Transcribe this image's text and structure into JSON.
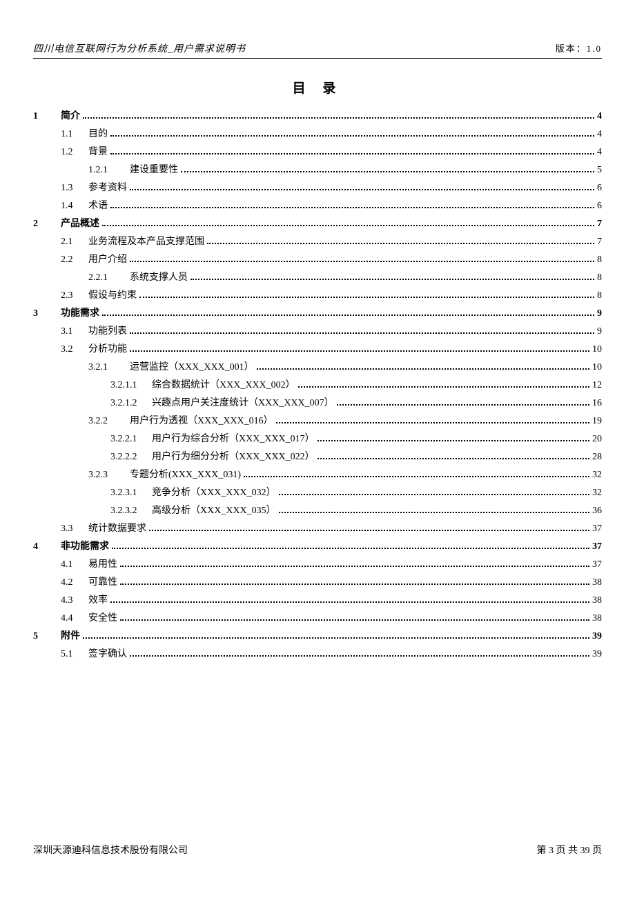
{
  "header": {
    "left": "四川电信互联网行为分析系统_用户需求说明书",
    "right": "版本：1.0"
  },
  "toc_title": "目 录",
  "toc": [
    {
      "level": 1,
      "num": "1",
      "title": "简介",
      "page": "4"
    },
    {
      "level": 2,
      "num": "1.1",
      "title": "目的",
      "page": "4"
    },
    {
      "level": 2,
      "num": "1.2",
      "title": "背景",
      "page": "4"
    },
    {
      "level": 3,
      "num": "1.2.1",
      "title": "建设重要性",
      "page": "5"
    },
    {
      "level": 2,
      "num": "1.3",
      "title": "参考资料",
      "page": "6"
    },
    {
      "level": 2,
      "num": "1.4",
      "title": "术语",
      "page": "6"
    },
    {
      "level": 1,
      "num": "2",
      "title": "产品概述",
      "page": "7"
    },
    {
      "level": 2,
      "num": "2.1",
      "title": "业务流程及本产品支撑范围",
      "page": "7"
    },
    {
      "level": 2,
      "num": "2.2",
      "title": "用户介绍",
      "page": "8"
    },
    {
      "level": 3,
      "num": "2.2.1",
      "title": "系统支撑人员",
      "page": "8"
    },
    {
      "level": 2,
      "num": "2.3",
      "title": "假设与约束",
      "page": "8"
    },
    {
      "level": 1,
      "num": "3",
      "title": "功能需求",
      "page": "9"
    },
    {
      "level": 2,
      "num": "3.1",
      "title": "功能列表",
      "page": "9"
    },
    {
      "level": 2,
      "num": "3.2",
      "title": "分析功能",
      "page": "10"
    },
    {
      "level": 3,
      "num": "3.2.1",
      "title": "运营监控（XXX_XXX_001）",
      "page": "10"
    },
    {
      "level": 4,
      "num": "3.2.1.1",
      "title": "综合数据统计（XXX_XXX_002）",
      "page": "12"
    },
    {
      "level": 4,
      "num": "3.2.1.2",
      "title": "兴趣点用户关注度统计（XXX_XXX_007）",
      "page": "16"
    },
    {
      "level": 3,
      "num": "3.2.2",
      "title": "用户行为透视（XXX_XXX_016）",
      "page": "19"
    },
    {
      "level": 4,
      "num": "3.2.2.1",
      "title": "用户行为综合分析（XXX_XXX_017）",
      "page": "20"
    },
    {
      "level": 4,
      "num": "3.2.2.2",
      "title": "用户行为细分分析（XXX_XXX_022）",
      "page": "28"
    },
    {
      "level": 3,
      "num": "3.2.3",
      "title": "专题分析(XXX_XXX_031)",
      "page": "32"
    },
    {
      "level": 4,
      "num": "3.2.3.1",
      "title": "竞争分析（XXX_XXX_032）",
      "page": "32"
    },
    {
      "level": 4,
      "num": "3.2.3.2",
      "title": "高级分析（XXX_XXX_035）",
      "page": "36"
    },
    {
      "level": 2,
      "num": "3.3",
      "title": "统计数据要求",
      "page": "37"
    },
    {
      "level": 1,
      "num": "4",
      "title": "非功能需求",
      "page": "37"
    },
    {
      "level": 2,
      "num": "4.1",
      "title": "易用性",
      "page": "37"
    },
    {
      "level": 2,
      "num": "4.2",
      "title": "可靠性",
      "page": "38"
    },
    {
      "level": 2,
      "num": "4.3",
      "title": "效率",
      "page": "38"
    },
    {
      "level": 2,
      "num": "4.4",
      "title": "安全性",
      "page": "38"
    },
    {
      "level": 1,
      "num": "5",
      "title": "附件",
      "page": "39"
    },
    {
      "level": 2,
      "num": "5.1",
      "title": "签字确认",
      "page": "39"
    }
  ],
  "footer": {
    "left": "深圳天源迪科信息技术股份有限公司",
    "right": "第 3 页 共 39 页"
  }
}
